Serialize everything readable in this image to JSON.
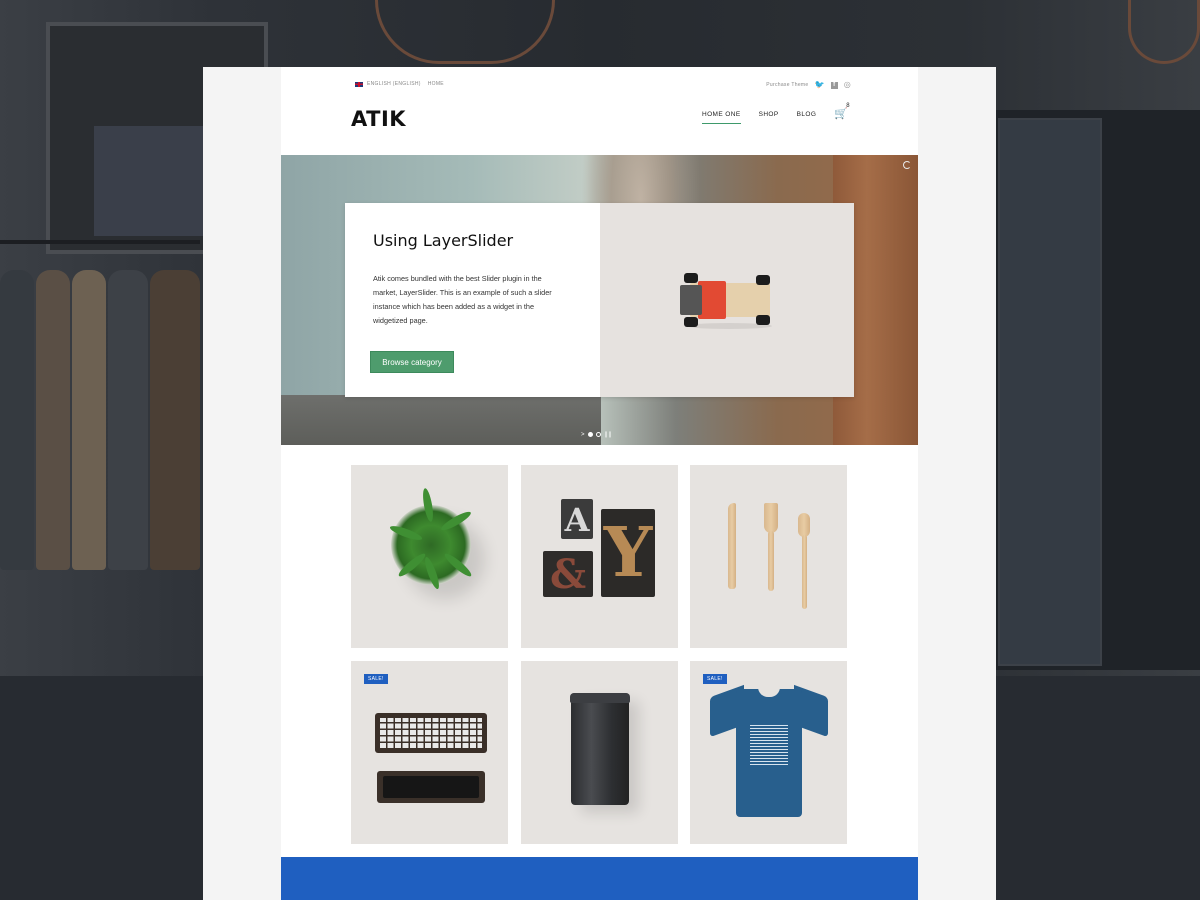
{
  "topbar": {
    "language": "English (English)",
    "home_link": "Home",
    "purchase_link": "Purchase Theme",
    "social_icons": [
      "twitter-icon",
      "facebook-icon",
      "dribbble-icon"
    ]
  },
  "header": {
    "logo": "ATIK",
    "nav": [
      {
        "label": "HOME ONE",
        "active": true
      },
      {
        "label": "SHOP",
        "active": false
      },
      {
        "label": "BLOG",
        "active": false
      }
    ],
    "cart_count": "8"
  },
  "hero": {
    "title": "Using LayerSlider",
    "description": "Atik comes bundled with the best Slider plugin in the market, LayerSlider. This is an example of such a slider instance which has been added as a widget in the widgetized page.",
    "button_label": "Browse category",
    "slide_count": 2,
    "active_slide": 1
  },
  "products": [
    {
      "name": "plant",
      "sale": false
    },
    {
      "name": "letter blocks",
      "sale": false
    },
    {
      "name": "wooden cutlery",
      "sale": false
    },
    {
      "name": "keyboard",
      "sale": true
    },
    {
      "name": "tin can",
      "sale": false
    },
    {
      "name": "t-shirt",
      "sale": true
    }
  ],
  "sale_badge": "SALE!",
  "letters": {
    "a": "A",
    "y": "Y",
    "amp": "&"
  },
  "colors": {
    "accent_green": "#4e9c6d",
    "sale_blue": "#1f5fc0",
    "tile_bg": "#e6e3e0"
  }
}
